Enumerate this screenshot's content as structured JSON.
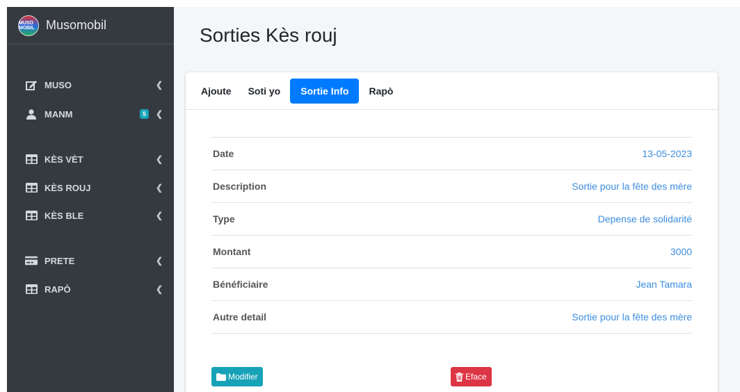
{
  "app": {
    "brand_name": "Musomobil",
    "logo_text": "MUSO MOBIL"
  },
  "sidebar": {
    "items": [
      {
        "label": "MUSO",
        "icon": "edit-icon"
      },
      {
        "label": "MANM",
        "icon": "user-icon",
        "badge": "5"
      },
      {
        "label": "KÈS VÈT",
        "icon": "table-icon"
      },
      {
        "label": "KÈS ROUJ",
        "icon": "table-icon"
      },
      {
        "label": "KÈS BLE",
        "icon": "table-icon"
      },
      {
        "label": "PRETE",
        "icon": "money-icon"
      },
      {
        "label": "RAPÒ",
        "icon": "table-icon"
      }
    ]
  },
  "page": {
    "title": "Sorties Kès rouj"
  },
  "tabs": [
    {
      "label": "Ajoute",
      "active": false
    },
    {
      "label": "Soti yo",
      "active": false
    },
    {
      "label": "Sortie Info",
      "active": true
    },
    {
      "label": "Rapò",
      "active": false
    }
  ],
  "details": [
    {
      "label": "Date",
      "value": "13-05-2023"
    },
    {
      "label": "Description",
      "value": "Sortie pour la fête des mère"
    },
    {
      "label": "Type",
      "value": "Depense de solidarité"
    },
    {
      "label": "Montant",
      "value": "3000"
    },
    {
      "label": "Bénéficiaire",
      "value": "Jean Tamara"
    },
    {
      "label": "Autre detail",
      "value": "Sortie pour la fête des mère"
    }
  ],
  "actions": {
    "edit_label": "Modifier",
    "delete_label": "Eface"
  },
  "colors": {
    "sidebar_bg": "#343a40",
    "accent": "#007bff",
    "value_link": "#3c8dde",
    "edit_button": "#17a2b8",
    "delete_button": "#dc3545"
  }
}
